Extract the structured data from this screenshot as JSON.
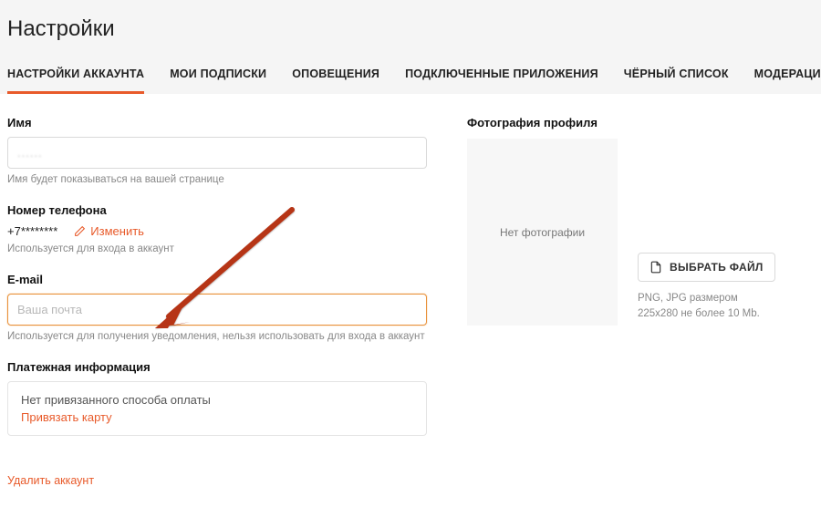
{
  "header": {
    "title": "Настройки"
  },
  "tabs": [
    {
      "label": "НАСТРОЙКИ АККАУНТА",
      "active": true
    },
    {
      "label": "МОИ ПОДПИСКИ"
    },
    {
      "label": "ОПОВЕЩЕНИЯ"
    },
    {
      "label": "ПОДКЛЮЧЕННЫЕ ПРИЛОЖЕНИЯ"
    },
    {
      "label": "ЧЁРНЫЙ СПИСОК"
    },
    {
      "label": "МОДЕРАЦИЯ ЧАТА"
    }
  ],
  "name_field": {
    "label": "Имя",
    "value": "",
    "helper": "Имя будет показываться на вашей странице"
  },
  "phone_field": {
    "label": "Номер телефона",
    "value": "+7********",
    "edit_label": "Изменить",
    "helper": "Используется для входа в аккаунт"
  },
  "email_field": {
    "label": "E-mail",
    "placeholder": "Ваша почта",
    "value": "",
    "helper": "Используется для получения уведомления, нельзя использовать для входа в аккаунт"
  },
  "payment": {
    "label": "Платежная информация",
    "none_text": "Нет привязанного способа оплаты",
    "link_text": "Привязать карту"
  },
  "delete_account": "Удалить аккаунт",
  "photo": {
    "label": "Фотография профиля",
    "placeholder_text": "Нет фотографии",
    "choose_button": "ВЫБРАТЬ ФАЙЛ",
    "hint_line1": "PNG, JPG размером",
    "hint_line2": "225x280 не более 10 Mb."
  }
}
